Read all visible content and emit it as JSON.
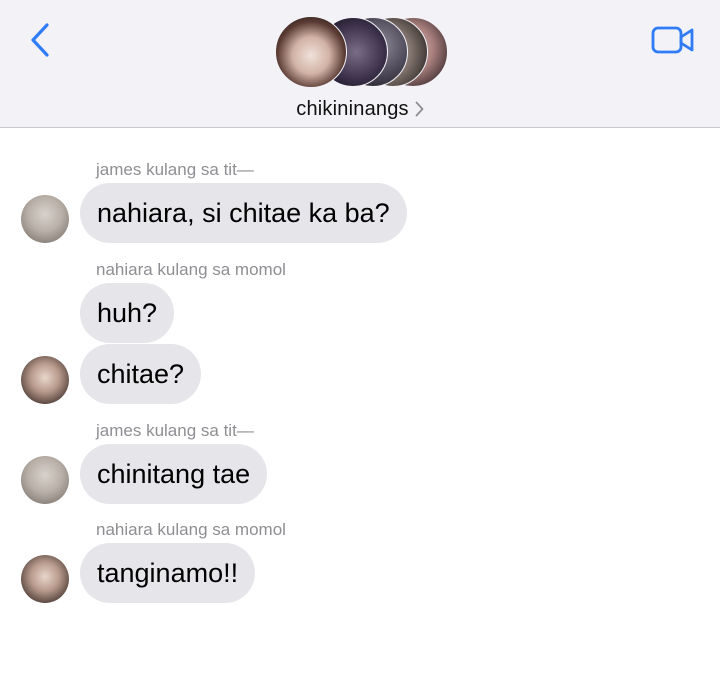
{
  "header": {
    "group_name": "chikininangs",
    "back_icon": "chevron-left-icon",
    "video_icon": "video-camera-icon",
    "accent_color": "#2f7cf6"
  },
  "messages": [
    {
      "sender": "james kulang sa tit—",
      "text": "nahiara, si chitae ka ba?"
    },
    {
      "sender": "nahiara kulang sa momol",
      "text": "huh?"
    },
    {
      "text": "chitae?"
    },
    {
      "sender": "james kulang sa tit—",
      "text": "chinitang tae"
    },
    {
      "sender": "nahiara kulang sa momol",
      "text": "tanginamo!!"
    }
  ]
}
